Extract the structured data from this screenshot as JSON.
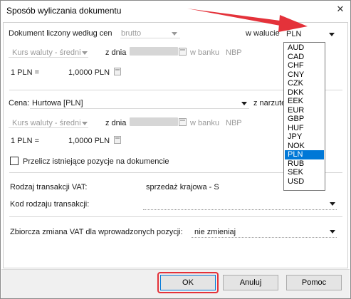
{
  "window": {
    "title": "Sposób wyliczania dokumentu",
    "close_glyph": "✕"
  },
  "top": {
    "doc_label": "Dokument liczony według cen",
    "doc_value": "brutto",
    "currency_label": "w walucie",
    "currency_value": "PLN"
  },
  "rate1": {
    "type": "Kurs waluty - średni",
    "date_label": "z dnia",
    "bank_label": "w banku",
    "bank_value": "NBP",
    "ratio_label": "1 PLN =",
    "ratio_value": "1,0000 PLN"
  },
  "price": {
    "label": "Cena:",
    "value": "Hurtowa [PLN]",
    "markup_label": "z narzutem"
  },
  "rate2": {
    "type": "Kurs waluty - średni",
    "date_label": "z dnia",
    "bank_label": "w banku",
    "bank_value": "NBP",
    "ratio_label": "1 PLN =",
    "ratio_value": "1,0000 PLN"
  },
  "recalc_checkbox": {
    "label": "Przelicz istniejące pozycje na dokumencie",
    "checked": false
  },
  "vat": {
    "label": "Rodzaj transakcji VAT:",
    "value": "sprzedaż krajowa - S"
  },
  "kod": {
    "label": "Kod rodzaju transakcji:",
    "value": ""
  },
  "zbiorcza": {
    "label": "Zbiorcza zmiana VAT dla wprowadzonych pozycji:",
    "value": "nie zmieniaj"
  },
  "currency_dropdown": {
    "options": [
      "AUD",
      "CAD",
      "CHF",
      "CNY",
      "CZK",
      "DKK",
      "EEK",
      "EUR",
      "GBP",
      "HUF",
      "JPY",
      "NOK",
      "PLN",
      "RUB",
      "SEK",
      "USD"
    ],
    "selected": "PLN"
  },
  "buttons": {
    "ok": "OK",
    "cancel": "Anuluj",
    "help": "Pomoc"
  },
  "colors": {
    "annotation_red": "#e4323a",
    "selection_blue": "#0078d7"
  }
}
